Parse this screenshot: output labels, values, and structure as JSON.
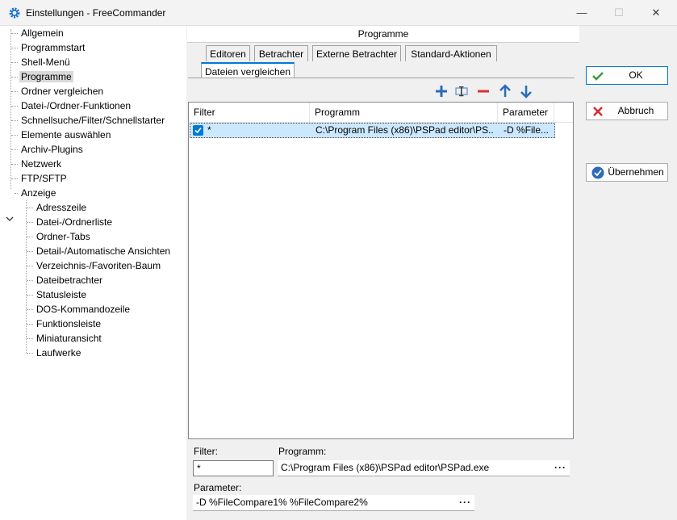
{
  "window": {
    "title": "Einstellungen - FreeCommander",
    "minimize": "—",
    "maximize": "☐",
    "close": "✕"
  },
  "tree": {
    "items": [
      {
        "label": "Allgemein"
      },
      {
        "label": "Programmstart"
      },
      {
        "label": "Shell-Menü"
      },
      {
        "label": "Programme",
        "selected": true
      },
      {
        "label": "Ordner vergleichen"
      },
      {
        "label": "Datei-/Ordner-Funktionen"
      },
      {
        "label": "Schnellsuche/Filter/Schnellstarter"
      },
      {
        "label": "Elemente auswählen"
      },
      {
        "label": "Archiv-Plugins"
      },
      {
        "label": "Netzwerk"
      },
      {
        "label": "FTP/SFTP"
      },
      {
        "label": "Anzeige",
        "expanded": true
      }
    ],
    "children": [
      {
        "label": "Adresszeile"
      },
      {
        "label": "Datei-/Ordnerliste"
      },
      {
        "label": "Ordner-Tabs"
      },
      {
        "label": "Detail-/Automatische Ansichten"
      },
      {
        "label": "Verzeichnis-/Favoriten-Baum"
      },
      {
        "label": "Dateibetrachter"
      },
      {
        "label": "Statusleiste"
      },
      {
        "label": "DOS-Kommandozeile"
      },
      {
        "label": "Funktionsleiste"
      },
      {
        "label": "Miniaturansicht"
      },
      {
        "label": "Laufwerke"
      }
    ]
  },
  "panel": {
    "header": "Programme",
    "tabs_row1": [
      {
        "label": "Editoren"
      },
      {
        "label": "Betrachter"
      },
      {
        "label": "Externe Betrachter"
      },
      {
        "label": "Standard-Aktionen"
      }
    ],
    "tabs_row2": [
      {
        "label": "Dateien vergleichen",
        "active": true
      }
    ]
  },
  "list": {
    "columns": [
      "Filter",
      "Programm",
      "Parameter"
    ],
    "rows": [
      {
        "checked": true,
        "filter": "*",
        "programm": "C:\\Program Files (x86)\\PSPad editor\\PS...",
        "parameter": "-D %File..."
      }
    ]
  },
  "form": {
    "filter_label": "Filter:",
    "filter_value": "*",
    "programm_label": "Programm:",
    "programm_value": "C:\\Program Files (x86)\\PSPad editor\\PSPad.exe",
    "parameter_label": "Parameter:",
    "parameter_value": "-D %FileCompare1% %FileCompare2%",
    "browse": "···"
  },
  "buttons": {
    "ok": "OK",
    "cancel": "Abbruch",
    "apply": "Übernehmen"
  },
  "colors": {
    "accent": "#0078d7",
    "ok_green": "#3a9a3a",
    "cancel_red": "#d03030",
    "toolbar_blue": "#2b6cb8",
    "remove_red": "#e03030"
  }
}
